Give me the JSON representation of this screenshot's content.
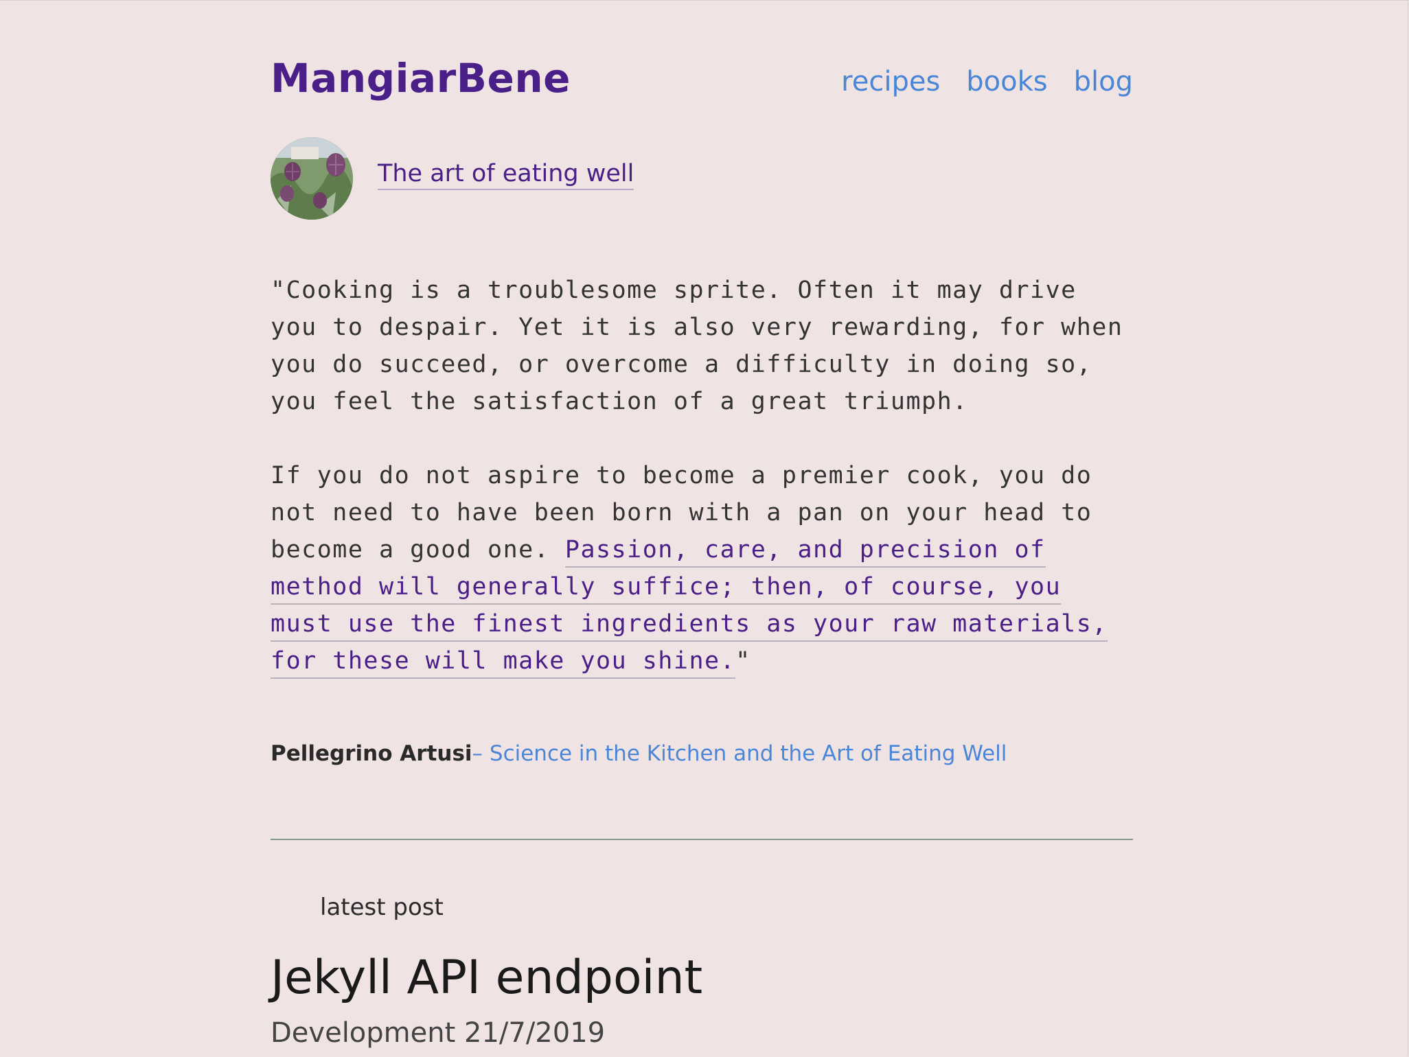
{
  "header": {
    "brand": "MangiarBene",
    "nav": [
      {
        "label": "recipes"
      },
      {
        "label": "books"
      },
      {
        "label": "blog"
      }
    ]
  },
  "intro": {
    "avatar_icon": "artichoke-photo",
    "tagline": "The art of eating well"
  },
  "quote": {
    "paragraph1": "\"Cooking is a troublesome sprite. Often it may drive you to despair. Yet it is also very rewarding, for when you do succeed, or overcome a difficulty in doing so, you feel the satisfaction of a great triumph.",
    "paragraph2_lead": "If you do not aspire to become a premier cook, you do not need to have been born with a pan on your head to become a good one. ",
    "paragraph2_link": "Passion, care, and precision of method will generally suffice; then, of course, you must use the finest ingredients as your raw materials, for these will make you shine.",
    "paragraph2_tail": "\""
  },
  "attribution": {
    "author": "Pellegrino Artusi",
    "book": "– Science in the Kitchen and the Art of Eating Well"
  },
  "latest": {
    "label": "latest post",
    "title": "Jekyll API endpoint",
    "meta": "Development 21/7/2019"
  },
  "colors": {
    "background": "#f0e3e3",
    "brand": "#4a2088",
    "link": "#4a86d8"
  }
}
